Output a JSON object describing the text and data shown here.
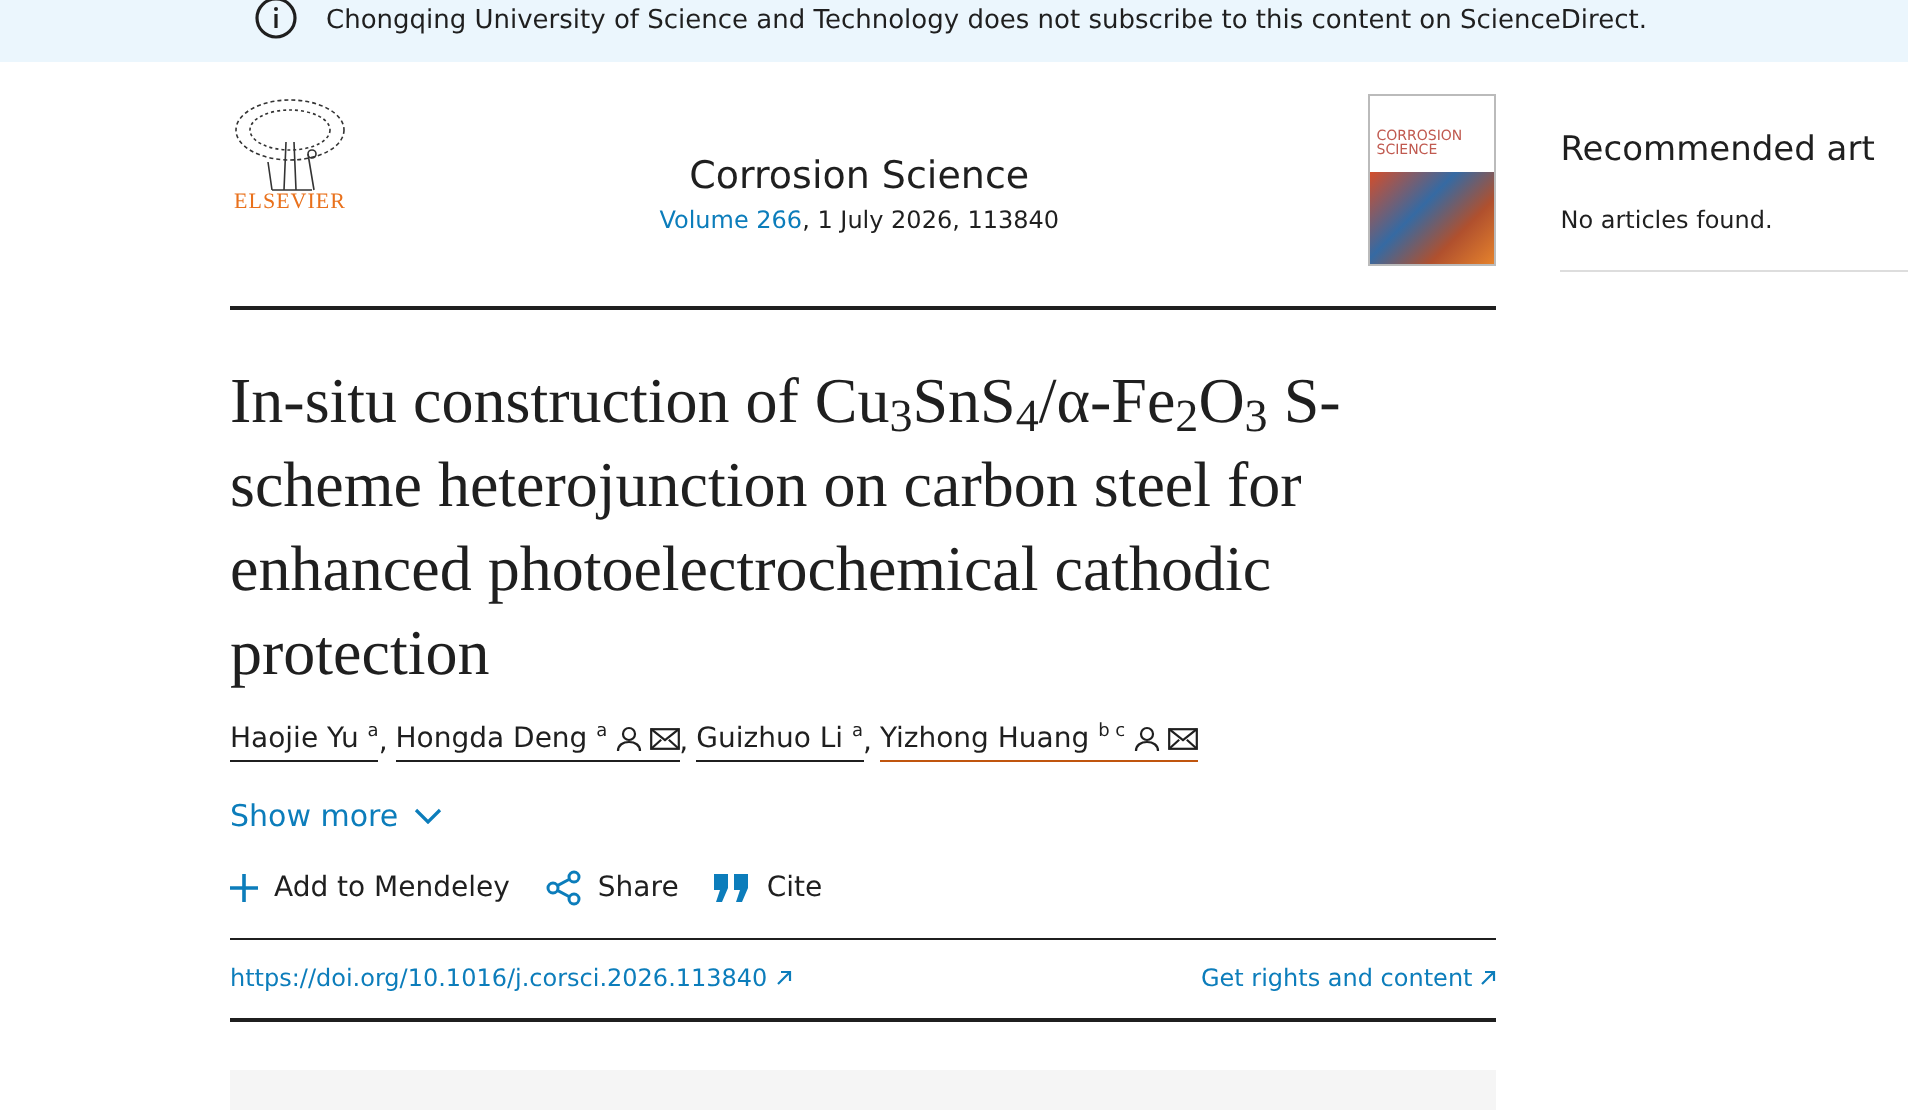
{
  "banner": {
    "text": "Chongqing University of Science and Technology does not subscribe to this content on ScienceDirect."
  },
  "header": {
    "publisher": "ELSEVIER",
    "journal": "Corrosion Science",
    "volume_link": "Volume 266",
    "issue_info": ", 1 July 2026, 113840",
    "cover_title": "CORROSION SCIENCE"
  },
  "article": {
    "title": "In-situ construction of Cu$_{3}$SnS$_{4}$/α-Fe$_{2}$O$_{3}$ S-scheme heterojunction on carbon steel for enhanced photoelectrochemical cathodic protection",
    "authors": [
      {
        "name": "Haojie Yu",
        "affiliations": "a",
        "corresponding": false,
        "highlighted": false,
        "separator": ","
      },
      {
        "name": "Hongda Deng",
        "affiliations": "a",
        "corresponding": true,
        "highlighted": false,
        "separator": ","
      },
      {
        "name": "Guizhuo Li",
        "affiliations": "a",
        "corresponding": false,
        "highlighted": false,
        "separator": ","
      },
      {
        "name": "Yizhong Huang",
        "affiliations": "b c",
        "corresponding": true,
        "highlighted": true
      }
    ],
    "show_more": "Show more",
    "actions": [
      {
        "kind": "add",
        "label": "Add to Mendeley"
      },
      {
        "kind": "share",
        "label": "Share"
      },
      {
        "kind": "cite",
        "label": "Cite"
      }
    ],
    "doi": "https://doi.org/10.1016/j.corsci.2026.113840",
    "rights": "Get rights and content"
  },
  "sidebar": {
    "heading": "Recommended art",
    "empty_message": "No articles found."
  }
}
